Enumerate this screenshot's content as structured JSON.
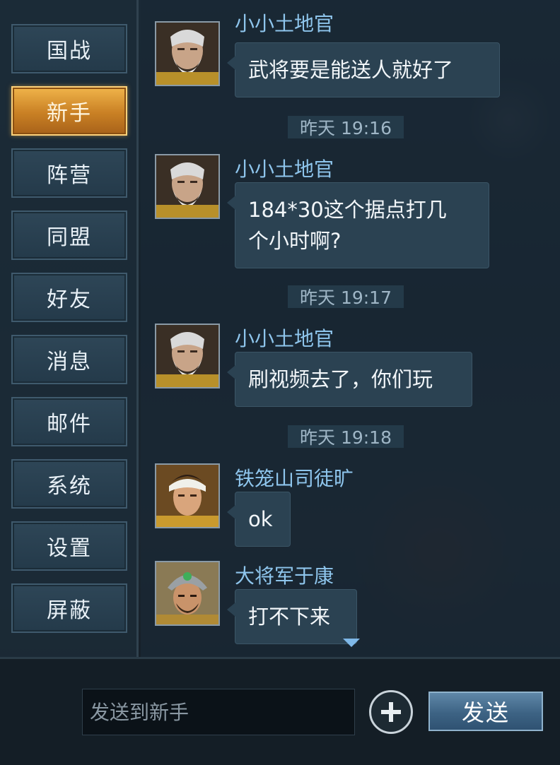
{
  "sidebar": {
    "items": [
      {
        "label": "国战",
        "active": false
      },
      {
        "label": "新手",
        "active": true
      },
      {
        "label": "阵营",
        "active": false
      },
      {
        "label": "同盟",
        "active": false
      },
      {
        "label": "好友",
        "active": false
      },
      {
        "label": "消息",
        "active": false
      },
      {
        "label": "邮件",
        "active": false
      },
      {
        "label": "系统",
        "active": false
      },
      {
        "label": "设置",
        "active": false
      },
      {
        "label": "屏蔽",
        "active": false
      }
    ]
  },
  "chat": {
    "messages": [
      {
        "sender": "小小土地官",
        "text": "武将要是能送人就好了",
        "avatar": "elder-general-avatar"
      },
      {
        "time": "昨天 19:16"
      },
      {
        "sender": "小小土地官",
        "text": "184*30这个据点打几\n个小时啊?",
        "avatar": "elder-general-avatar"
      },
      {
        "time": "昨天 19:17"
      },
      {
        "sender": "小小土地官",
        "text": "刷视频去了，你们玩",
        "avatar": "elder-general-avatar"
      },
      {
        "time": "昨天 19:18"
      },
      {
        "sender": "铁笼山司徒旷",
        "text": "ok",
        "avatar": "young-warrior-avatar"
      },
      {
        "sender": "大将军于康",
        "text": "打不下来",
        "avatar": "armored-general-avatar"
      }
    ]
  },
  "input": {
    "placeholder": "发送到新手",
    "send_label": "发送",
    "add_icon": "plus-circle-icon"
  },
  "colors": {
    "active_tab": "#d8922f",
    "sender_name": "#8ec5ec",
    "bubble": "#2b4252"
  }
}
